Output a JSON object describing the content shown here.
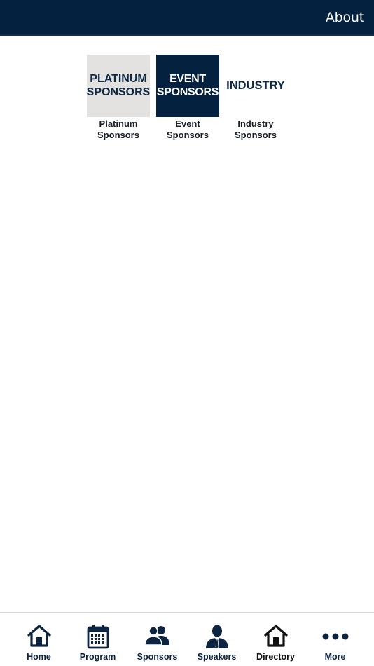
{
  "header": {
    "about_label": "About"
  },
  "tiles": [
    {
      "thumb_line1": "PLATINUM",
      "thumb_line2": "SPONSORS",
      "caption_line1": "Platinum",
      "caption_line2": "Sponsors"
    },
    {
      "thumb_line1": "EVENT",
      "thumb_line2": "SPONSORS",
      "caption_line1": "Event",
      "caption_line2": "Sponsors"
    },
    {
      "thumb_line1": "INDUSTRY",
      "caption_line1": "Industry",
      "caption_line2": "Sponsors"
    }
  ],
  "tabbar": {
    "items": [
      {
        "label": "Home",
        "icon": "home-icon"
      },
      {
        "label": "Program",
        "icon": "calendar-icon"
      },
      {
        "label": "Sponsors",
        "icon": "people-icon"
      },
      {
        "label": "Speakers",
        "icon": "speaker-icon"
      },
      {
        "label": "Directory",
        "icon": "directory-home-icon"
      },
      {
        "label": "More",
        "icon": "more-dots-icon"
      }
    ]
  },
  "colors": {
    "navy": "#042240",
    "tile_grey": "#e3e2e0"
  }
}
